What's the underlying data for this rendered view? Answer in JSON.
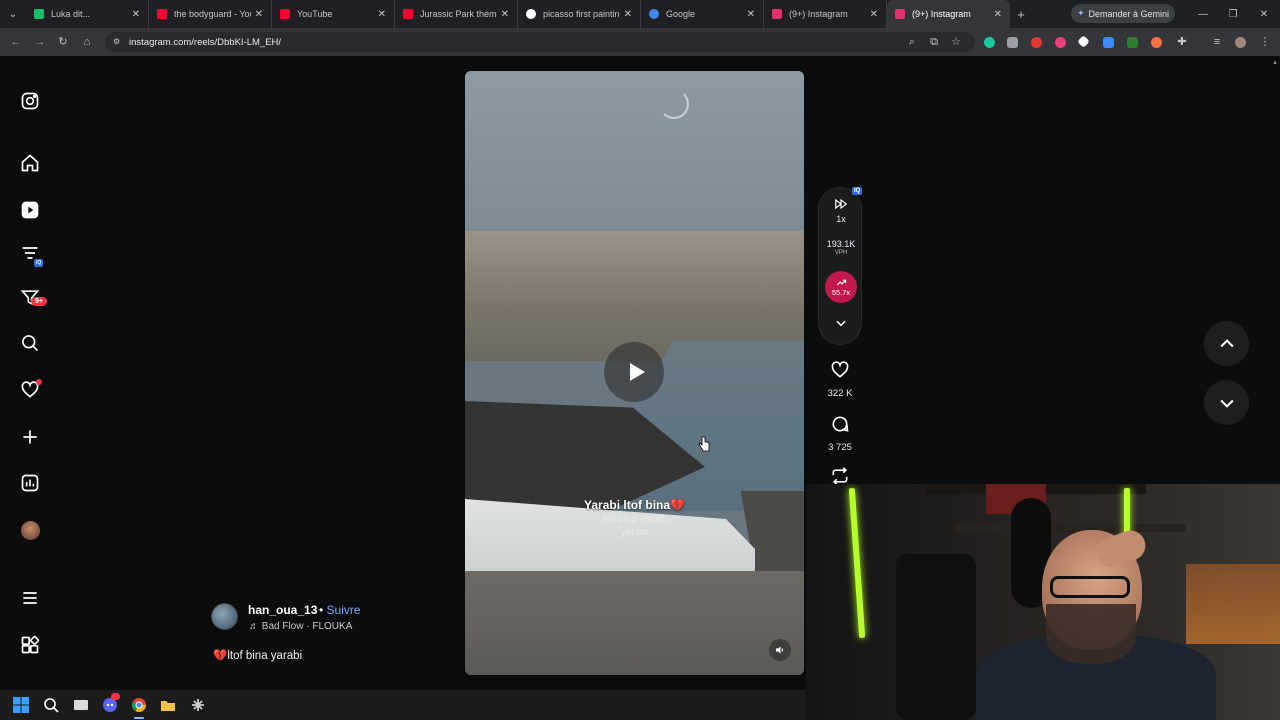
{
  "browser": {
    "tabs": [
      {
        "label": "Luka dit...",
        "favicon_color": "#15c26b"
      },
      {
        "label": "the bodyguard - YouTube",
        "favicon_color": "#ff0033"
      },
      {
        "label": "YouTube",
        "favicon_color": "#ff0033"
      },
      {
        "label": "Jurassic Park theme s",
        "favicon_color": "#ff0033"
      },
      {
        "label": "picasso first painting",
        "favicon_color": "#ffffff"
      },
      {
        "label": "Google",
        "favicon_color": "#4285f4"
      },
      {
        "label": "(9+) Instagram",
        "favicon_color": "#e1306c"
      },
      {
        "label": "(9+) Instagram",
        "favicon_color": "#e1306c"
      }
    ],
    "active_tab_index": 7,
    "gemini_label": "Demander à Gemini",
    "url": "instagram.com/reels/DbbKI-LM_EH/"
  },
  "sidebar": {
    "messages_badge": "9+"
  },
  "reel": {
    "overlay_caption": "Yarabi ltof bina💔",
    "overlay_faint_1": "ltof bina yarabi",
    "overlay_faint_2": "yarabi",
    "username": "han_oua_13",
    "separator": "•",
    "follow_label": "Suivre",
    "audio": "Bad Flow · FLOUKA",
    "description": "💔ltof bina yarabi"
  },
  "speed_widget": {
    "iq_tag": "IQ",
    "speed": "1x",
    "views_per_hour": "193.1K",
    "vph_label": "VPH",
    "multiplier": "55.7x"
  },
  "actions": {
    "likes": "322 K",
    "comments": "3 725"
  },
  "colors": {
    "accent_link": "#7aa7ff",
    "badge": "#ff3040",
    "trend": "#c2184b"
  }
}
